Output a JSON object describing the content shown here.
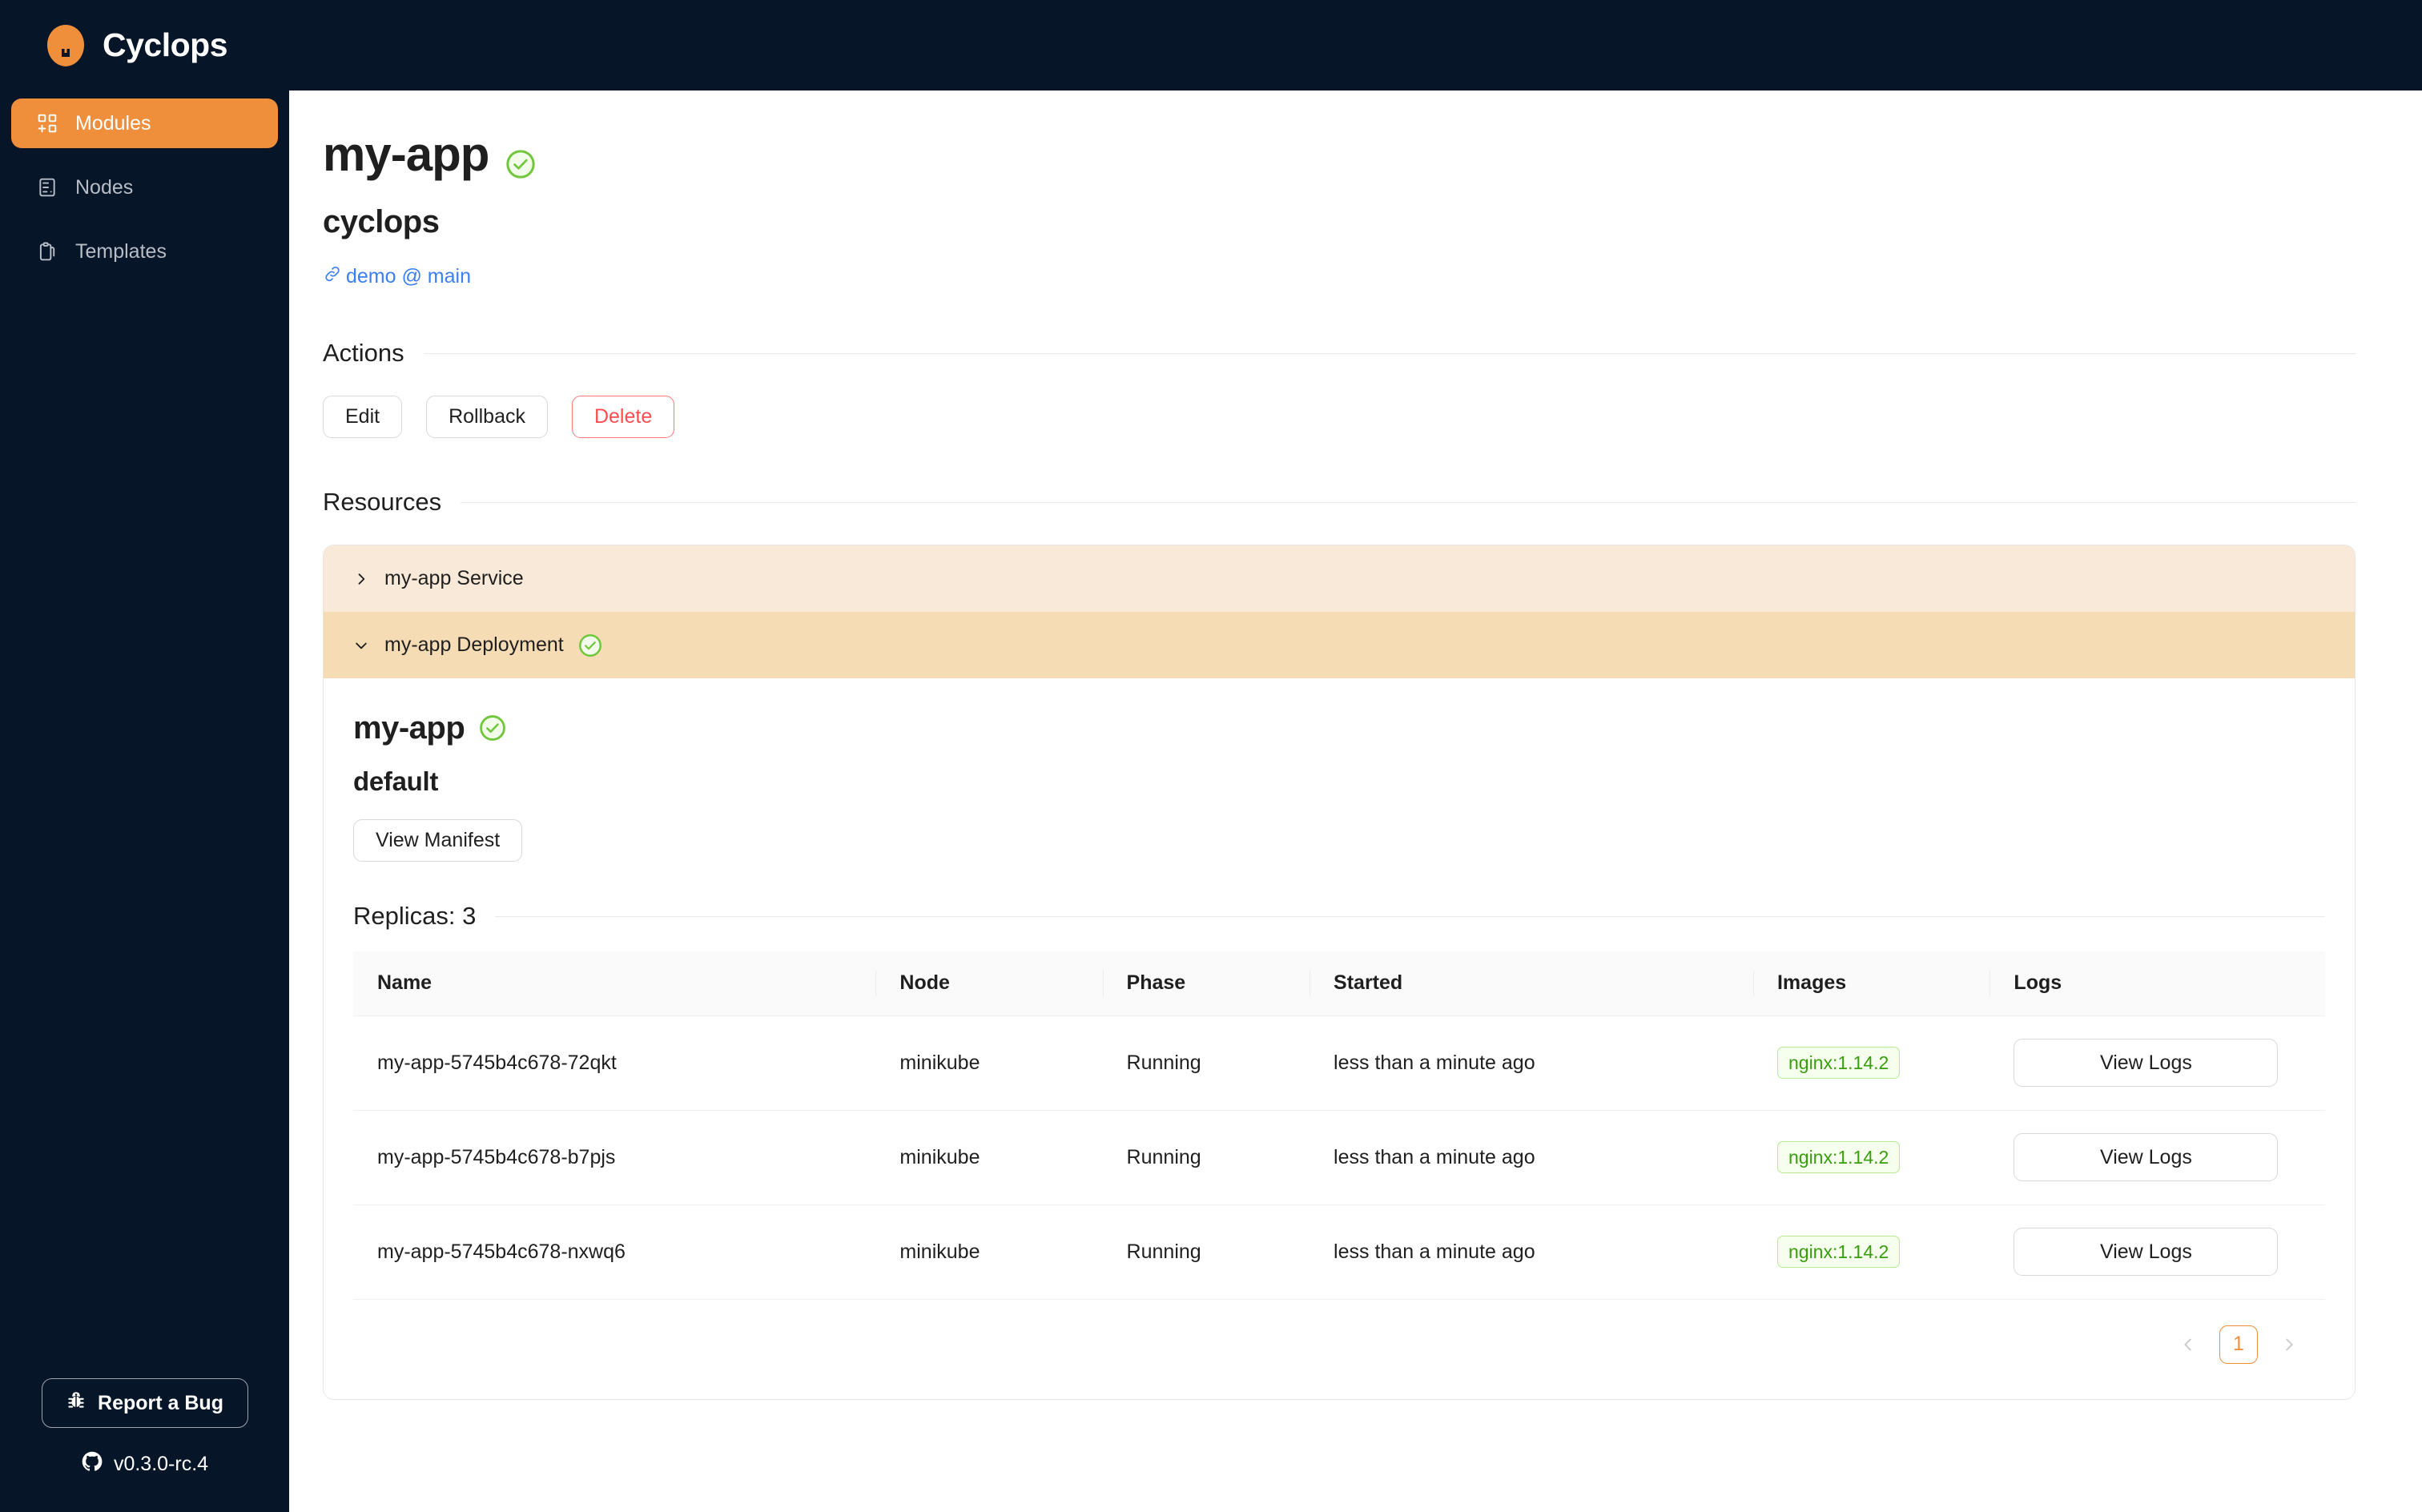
{
  "brand": {
    "name": "Cyclops",
    "logo_icon": "cyclops-logo-icon"
  },
  "sidebar": {
    "items": [
      {
        "label": "Modules",
        "icon": "modules-icon",
        "active": true
      },
      {
        "label": "Nodes",
        "icon": "server-icon",
        "active": false
      },
      {
        "label": "Templates",
        "icon": "clipboard-icon",
        "active": false
      }
    ],
    "report_bug_label": "Report a Bug",
    "report_bug_icon": "bug-icon",
    "version_label": "v0.3.0-rc.4",
    "version_icon": "github-icon",
    "bg_color": "#071528",
    "active_color": "#ef8f3c"
  },
  "page": {
    "title": "my-app",
    "status_icon": "check-circle-icon",
    "subtitle": "cyclops",
    "repo_link": "demo @ main",
    "repo_link_icon": "link-icon",
    "repo_link_color": "#3b7ff0"
  },
  "actions": {
    "heading": "Actions",
    "buttons": [
      {
        "label": "Edit",
        "style": "default"
      },
      {
        "label": "Rollback",
        "style": "default"
      },
      {
        "label": "Delete",
        "style": "danger"
      }
    ],
    "danger_color": "#ff4d4f"
  },
  "resources": {
    "heading": "Resources",
    "panels": [
      {
        "label": "my-app Service",
        "expanded": false,
        "chevron": "chevron-right-icon",
        "status_icon": null,
        "bg": "#f8e9d9"
      },
      {
        "label": "my-app Deployment",
        "expanded": true,
        "chevron": "chevron-down-icon",
        "status_icon": "check-circle-icon",
        "bg": "#f5dcb5"
      }
    ]
  },
  "deployment": {
    "name": "my-app",
    "status_icon": "check-circle-icon",
    "namespace": "default",
    "view_manifest_label": "View Manifest",
    "replicas_label": "Replicas: 3",
    "table": {
      "columns": [
        "Name",
        "Node",
        "Phase",
        "Started",
        "Images",
        "Logs"
      ],
      "rows": [
        {
          "name": "my-app-5745b4c678-72qkt",
          "node": "minikube",
          "phase": "Running",
          "started": "less than a minute ago",
          "image": "nginx:1.14.2",
          "logs_label": "View Logs"
        },
        {
          "name": "my-app-5745b4c678-b7pjs",
          "node": "minikube",
          "phase": "Running",
          "started": "less than a minute ago",
          "image": "nginx:1.14.2",
          "logs_label": "View Logs"
        },
        {
          "name": "my-app-5745b4c678-nxwq6",
          "node": "minikube",
          "phase": "Running",
          "started": "less than a minute ago",
          "image": "nginx:1.14.2",
          "logs_label": "View Logs"
        }
      ]
    },
    "pagination": {
      "prev_icon": "chevron-left-icon",
      "next_icon": "chevron-right-icon",
      "current_page": "1"
    },
    "image_tag_color": "#389e0d"
  }
}
